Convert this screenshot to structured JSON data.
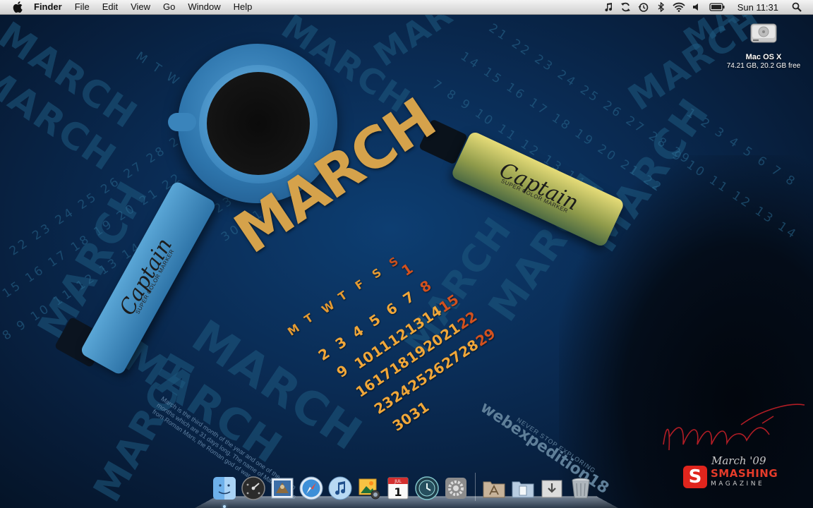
{
  "menubar": {
    "app_name": "Finder",
    "menus": [
      "File",
      "Edit",
      "View",
      "Go",
      "Window",
      "Help"
    ],
    "clock": "Sun 11:31"
  },
  "desktop": {
    "drive": {
      "label": "Mac OS X",
      "info": "74.21 GB, 20.2 GB free"
    }
  },
  "wallpaper": {
    "calendar": {
      "title": "MARCH",
      "weekdays": [
        "M",
        "T",
        "W",
        "T",
        "F",
        "S",
        "S"
      ],
      "weeks": [
        [
          "",
          "",
          "",
          "",
          "",
          "",
          "1"
        ],
        [
          "2",
          "3",
          "4",
          "5",
          "6",
          "7",
          "8"
        ],
        [
          "9",
          "10",
          "11",
          "12",
          "13",
          "14",
          "15"
        ],
        [
          "16",
          "17",
          "18",
          "19",
          "20",
          "21",
          "22"
        ],
        [
          "23",
          "24",
          "25",
          "26",
          "27",
          "28",
          "29"
        ],
        [
          "30",
          "31",
          "",
          "",
          "",
          "",
          ""
        ]
      ]
    },
    "markers": {
      "brand": "Captain",
      "subtitle": "SUPER COLOR MARKER"
    },
    "background_word": "MARCH",
    "description": "March is the third month of the year and one of the seven months which are 31 days long. The name of March comes from Roman Mars, the Roman god of war.",
    "webex_title": "webexpedition18",
    "webex_subtitle": "NEVER STOP EXPLORING",
    "brand_date": "March '09",
    "brand_logo_letter": "S",
    "brand_name": "SMASHING",
    "brand_sub": "MAGAZINE"
  },
  "dock": {
    "items": [
      "finder-icon",
      "dashboard-icon",
      "mail-icon",
      "safari-icon",
      "itunes-icon",
      "iphoto-icon",
      "ical-icon",
      "time-machine-icon",
      "system-preferences-icon",
      "applications-folder-icon",
      "documents-folder-icon",
      "downloads-folder-icon",
      "trash-icon"
    ],
    "ical_month": "JUL",
    "ical_day": "1"
  },
  "colors": {
    "calendar_days": "#f0a73a",
    "calendar_sundays": "#d2511f",
    "wallpaper_base": "#0a2c55",
    "brand_red": "#e53b2a"
  }
}
